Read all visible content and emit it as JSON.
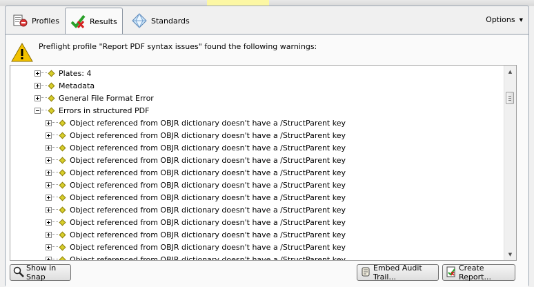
{
  "tabs": [
    {
      "label": "Profiles",
      "icon": "profiles-icon"
    },
    {
      "label": "Results",
      "icon": "results-checkmark-icon",
      "active": true
    },
    {
      "label": "Standards",
      "icon": "standards-crystal-icon"
    }
  ],
  "options": {
    "label": "Options"
  },
  "header": {
    "message": "Preflight profile \"Report PDF syntax issues\" found the following warnings:",
    "icon": "warning-icon"
  },
  "tree": {
    "top_items": [
      {
        "label": "Plates: 4",
        "expander": "plus"
      },
      {
        "label": "Metadata",
        "expander": "plus"
      },
      {
        "label": "General File Format Error",
        "expander": "plus"
      },
      {
        "label": "Errors in structured PDF",
        "expander": "minus"
      }
    ],
    "child_items": [
      {
        "label": "Object referenced from OBJR dictionary doesn't have a /StructParent key"
      },
      {
        "label": "Object referenced from OBJR dictionary doesn't have a /StructParent key"
      },
      {
        "label": "Object referenced from OBJR dictionary doesn't have a /StructParent key"
      },
      {
        "label": "Object referenced from OBJR dictionary doesn't have a /StructParent key"
      },
      {
        "label": "Object referenced from OBJR dictionary doesn't have a /StructParent key"
      },
      {
        "label": "Object referenced from OBJR dictionary doesn't have a /StructParent key"
      },
      {
        "label": "Object referenced from OBJR dictionary doesn't have a /StructParent key"
      },
      {
        "label": "Object referenced from OBJR dictionary doesn't have a /StructParent key"
      },
      {
        "label": "Object referenced from OBJR dictionary doesn't have a /StructParent key"
      },
      {
        "label": "Object referenced from OBJR dictionary doesn't have a /StructParent key"
      },
      {
        "label": "Object referenced from OBJR dictionary doesn't have a /StructParent key"
      },
      {
        "label": "Object referenced from OBJR dictionary doesn't have a /StructParent key"
      }
    ]
  },
  "buttons": {
    "show_in_snap": "Show in Snap",
    "embed_audit_trail": "Embed Audit Trail...",
    "create_report": "Create Report..."
  },
  "colors": {
    "diamond": "#d8cf2a",
    "warning": "#f2c200",
    "results_check": "#2aa02a",
    "results_x": "#d42020"
  }
}
